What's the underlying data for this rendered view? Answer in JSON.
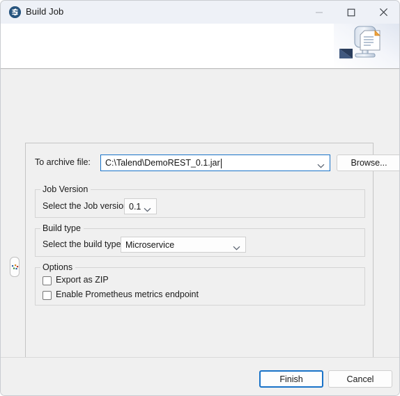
{
  "window": {
    "title": "Build Job",
    "app_icon": "talend-logo-icon",
    "controls": {
      "minimize": "minimize-icon",
      "maximize": "maximize-icon",
      "close": "close-icon"
    }
  },
  "header": {
    "banner_art": "build-job-illustration-icon"
  },
  "drawer": {
    "handle": "palette-drawer-handle-icon"
  },
  "form": {
    "archive": {
      "label": "To archive file:",
      "value": "C:\\Talend\\DemoREST_0.1.jar",
      "placeholder": "C:\\Talend\\DemoREST_0.1.jar",
      "browse_label": "Browse...",
      "dropdown_icon": "chevron-down-icon",
      "focus_color": "#1872c8"
    },
    "job_version": {
      "group_label": "Job Version",
      "field_label": "Select the Job version",
      "value": "0.1",
      "options": [
        "0.1"
      ],
      "dropdown_icon": "chevron-down-icon"
    },
    "build_type": {
      "group_label": "Build type",
      "field_label": "Select the build type",
      "value": "Microservice",
      "options": [
        "Microservice"
      ],
      "dropdown_icon": "chevron-down-icon"
    },
    "options": {
      "group_label": "Options",
      "items": [
        {
          "label": "Export as ZIP",
          "checked": false
        },
        {
          "label": "Enable Prometheus metrics endpoint",
          "checked": false
        }
      ]
    }
  },
  "footer": {
    "finish_label": "Finish",
    "cancel_label": "Cancel",
    "default_button_color": "#1872c8"
  }
}
